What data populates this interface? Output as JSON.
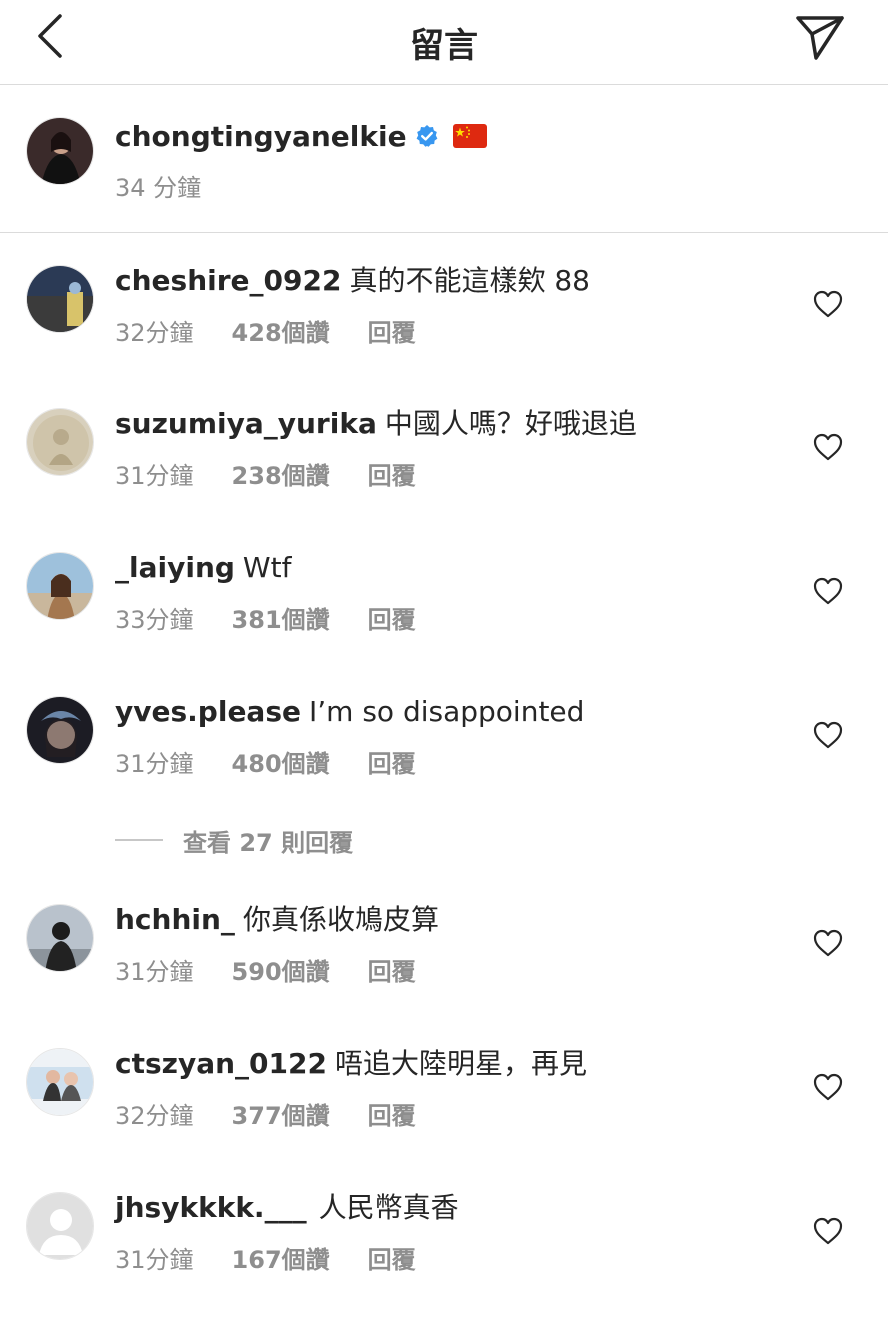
{
  "header": {
    "title": "留言",
    "back_icon": "chevron-left-icon",
    "share_icon": "paper-plane-icon"
  },
  "caption": {
    "username": "chongtingyanelkie",
    "verified": true,
    "flag": "🇨🇳",
    "time": "34 分鐘"
  },
  "comments": [
    {
      "username": "cheshire_0922",
      "text": "真的不能這樣欸 88",
      "time": "32分鐘",
      "likes": "428個讚",
      "reply": "回覆"
    },
    {
      "username": "suzumiya_yurika",
      "text": "中國人嗎？好哦退追",
      "time": "31分鐘",
      "likes": "238個讚",
      "reply": "回覆"
    },
    {
      "username": "_laiying",
      "text": "Wtf",
      "time": "33分鐘",
      "likes": "381個讚",
      "reply": "回覆"
    },
    {
      "username": "yves.please",
      "text": "I’m so disappointed",
      "time": "31分鐘",
      "likes": "480個讚",
      "reply": "回覆"
    },
    {
      "username": "hchhin_",
      "text": "你真係收鳩皮算",
      "time": "31分鐘",
      "likes": "590個讚",
      "reply": "回覆"
    },
    {
      "username": "ctszyan_0122",
      "text": "唔追大陸明星，再見",
      "time": "32分鐘",
      "likes": "377個讚",
      "reply": "回覆"
    },
    {
      "username": "jhsykkkk.___",
      "text": "人民幣真香",
      "time": "31分鐘",
      "likes": "167個讚",
      "reply": "回覆"
    }
  ],
  "view_replies": {
    "label": "查看 27 則回覆"
  },
  "colors": {
    "text_primary": "#262626",
    "text_secondary": "#8e8e8e",
    "divider": "#dbdbdb",
    "verified_blue": "#3897f0"
  }
}
